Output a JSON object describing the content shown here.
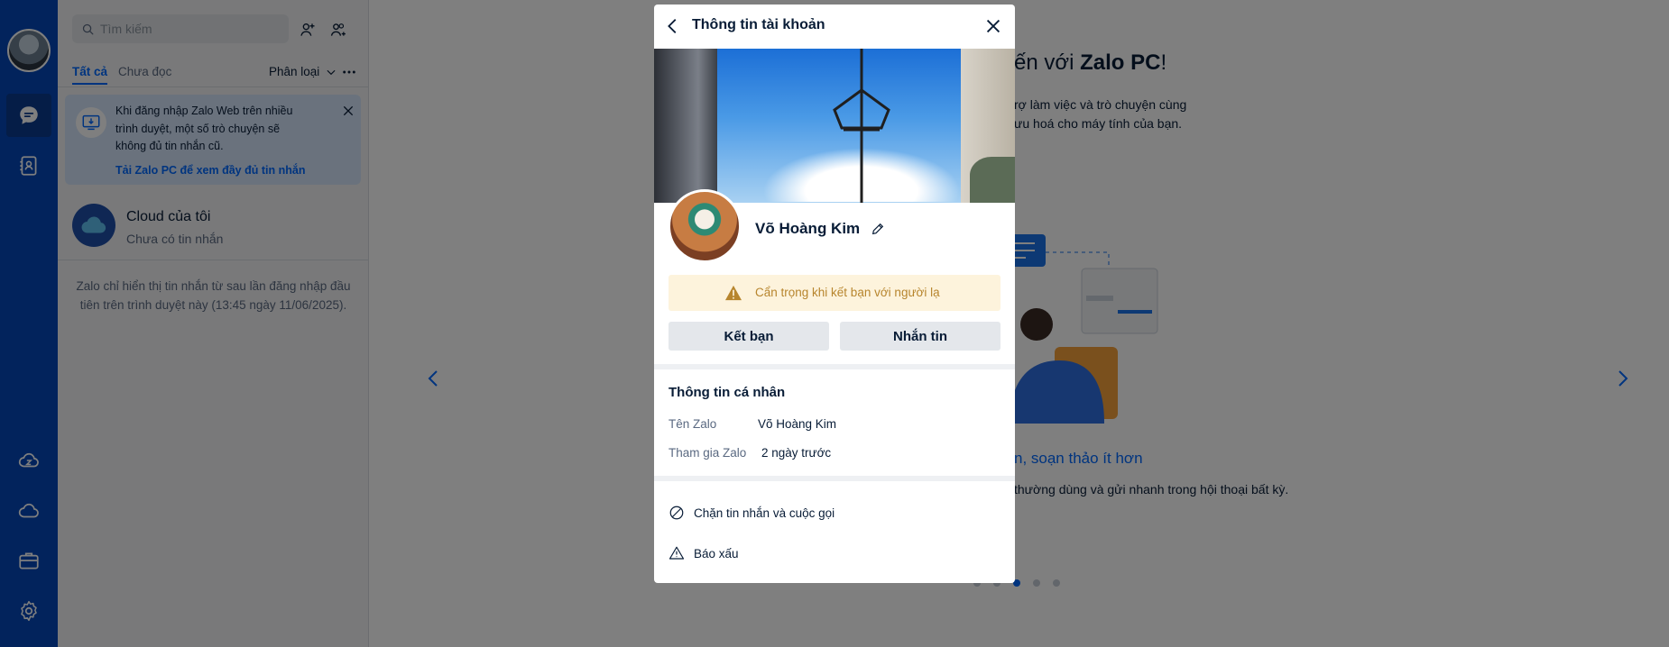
{
  "search": {
    "placeholder": "Tìm kiếm"
  },
  "tabs": {
    "all": "Tất cả",
    "unread": "Chưa đọc",
    "filter": "Phân loại"
  },
  "notice": {
    "text": "Khi đăng nhập Zalo Web trên nhiều trình duyệt, một số trò chuyện sẽ không đủ tin nhắn cũ.",
    "link": "Tải Zalo PC để xem đầy đủ tin nhắn"
  },
  "conversation": {
    "name": "Cloud của tôi",
    "last_message": "Chưa có tin nhắn"
  },
  "list_footer": "Zalo chỉ hiển thị tin nhắn từ sau lần đăng nhập đầu tiên trên trình duyệt này (13:45 ngày 11/06/2025).",
  "welcome": {
    "title_prefix": "ến với ",
    "title_brand": "Zalo PC",
    "title_suffix": "!",
    "subtitle_line1": "rợ làm việc và trò chuyện cùng",
    "subtitle_line2": "ưu hoá cho máy tính của bạn.",
    "slide_title": "n, soạn thảo ít hơn",
    "slide_desc": "thường dùng và gửi nhanh trong hội thoại bất kỳ.",
    "active_slide": 3,
    "slide_count": 5
  },
  "modal": {
    "title": "Thông tin tài khoản",
    "profile_name": "Võ Hoàng Kim",
    "warning": "Cẩn trọng khi kết bạn với người lạ",
    "add_friend_label": "Kết bạn",
    "message_label": "Nhắn tin",
    "section_title": "Thông tin cá nhân",
    "rows": [
      {
        "label": "Tên Zalo",
        "value": "Võ Hoàng Kim"
      },
      {
        "label": "Tham gia Zalo",
        "value": "2 ngày trước"
      }
    ],
    "actions": {
      "block": "Chặn tin nhắn và cuộc gọi",
      "report": "Báo xấu"
    }
  },
  "colors": {
    "rail": "#0447b8",
    "accent": "#0068ff",
    "warning_bg": "#fdf3dc",
    "warning_text": "#b7852d"
  },
  "icons": [
    "search-icon",
    "add-friend-icon",
    "create-group-icon",
    "chat-icon",
    "contacts-icon",
    "cloud-sync-icon",
    "cloud-icon",
    "briefcase-icon",
    "settings-icon",
    "download-pc-icon",
    "close-icon",
    "chevron-down-icon",
    "more-icon",
    "back-icon",
    "edit-icon",
    "warning-icon",
    "block-icon",
    "report-icon",
    "arrow-left-icon",
    "arrow-right-icon"
  ]
}
